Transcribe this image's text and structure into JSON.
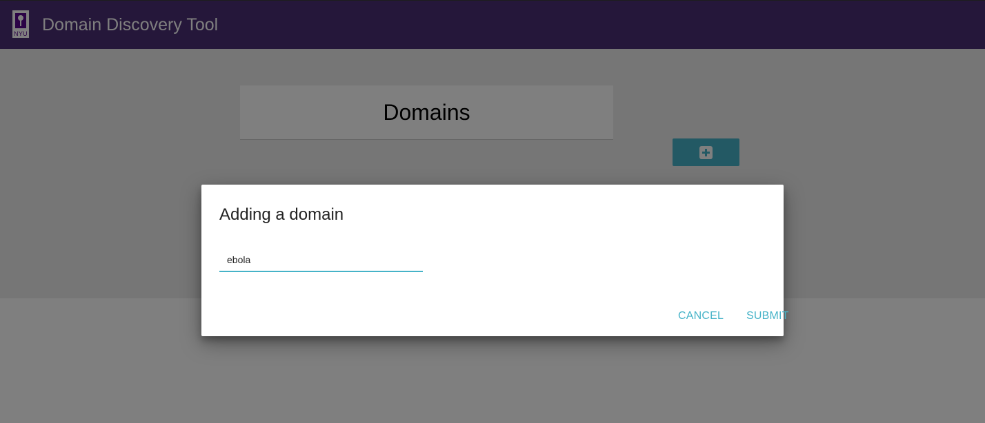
{
  "app": {
    "title": "Domain Discovery Tool",
    "logo_text": "NYU",
    "brand_color": "#4a2e74"
  },
  "main": {
    "domains_heading": "Domains",
    "add_button_icon": "plus-square-icon",
    "accent_color": "#46b3c8"
  },
  "dialog": {
    "title": "Adding a domain",
    "input_value": "ebola",
    "cancel_label": "CANCEL",
    "submit_label": "SUBMIT"
  }
}
